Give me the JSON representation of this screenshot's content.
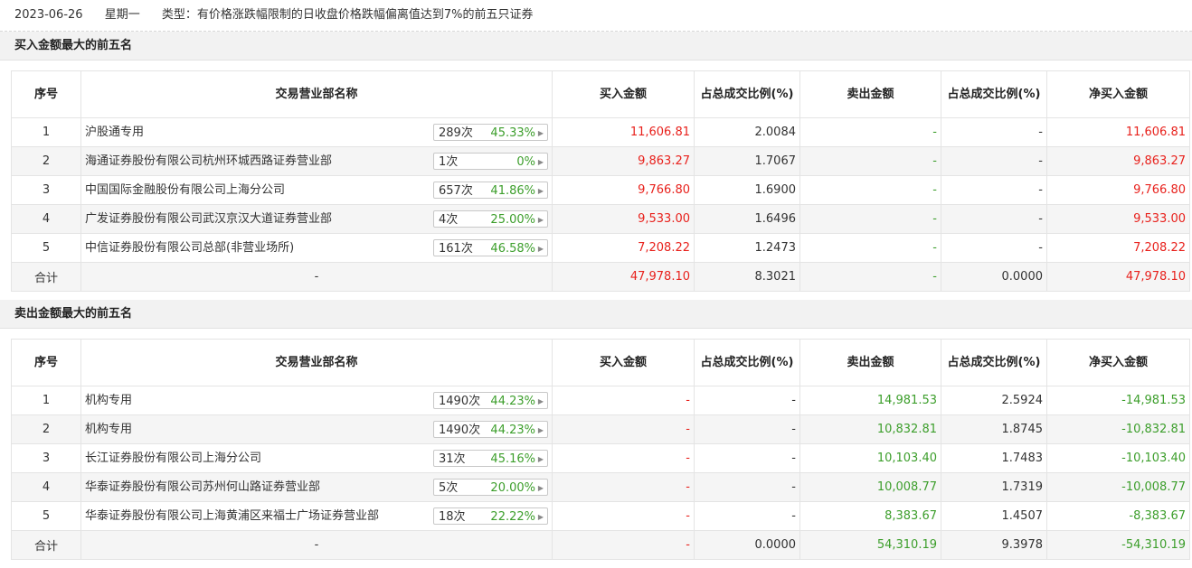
{
  "header": {
    "date": "2023-06-26",
    "weekday": "星期一",
    "type_label": "类型：",
    "type_text": "有价格涨跌幅限制的日收盘价格跌幅偏离值达到7%的前五只证券"
  },
  "columns": [
    "序号",
    "交易营业部名称",
    "买入金额",
    "占总成交比例(%)",
    "卖出金额",
    "占总成交比例(%)",
    "净买入金额"
  ],
  "buy_section": {
    "title": "买入金额最大的前五名",
    "rows": [
      {
        "no": "1",
        "name": "沪股通专用",
        "count": "289次",
        "pct": "45.33%",
        "buy": "11,606.81",
        "buy_ratio": "2.0084",
        "sell": "-",
        "sell_ratio": "-",
        "net": "11,606.81"
      },
      {
        "no": "2",
        "name": "海通证券股份有限公司杭州环城西路证券营业部",
        "count": "1次",
        "pct": "0%",
        "buy": "9,863.27",
        "buy_ratio": "1.7067",
        "sell": "-",
        "sell_ratio": "-",
        "net": "9,863.27"
      },
      {
        "no": "3",
        "name": "中国国际金融股份有限公司上海分公司",
        "count": "657次",
        "pct": "41.86%",
        "buy": "9,766.80",
        "buy_ratio": "1.6900",
        "sell": "-",
        "sell_ratio": "-",
        "net": "9,766.80"
      },
      {
        "no": "4",
        "name": "广发证券股份有限公司武汉京汉大道证券营业部",
        "count": "4次",
        "pct": "25.00%",
        "buy": "9,533.00",
        "buy_ratio": "1.6496",
        "sell": "-",
        "sell_ratio": "-",
        "net": "9,533.00"
      },
      {
        "no": "5",
        "name": "中信证券股份有限公司总部(非营业场所)",
        "count": "161次",
        "pct": "46.58%",
        "buy": "7,208.22",
        "buy_ratio": "1.2473",
        "sell": "-",
        "sell_ratio": "-",
        "net": "7,208.22"
      }
    ],
    "total": {
      "label": "合计",
      "name": "-",
      "buy": "47,978.10",
      "buy_ratio": "8.3021",
      "sell": "-",
      "sell_ratio": "0.0000",
      "net": "47,978.10"
    }
  },
  "sell_section": {
    "title": "卖出金额最大的前五名",
    "rows": [
      {
        "no": "1",
        "name": "机构专用",
        "count": "1490次",
        "pct": "44.23%",
        "buy": "-",
        "buy_ratio": "-",
        "sell": "14,981.53",
        "sell_ratio": "2.5924",
        "net": "-14,981.53"
      },
      {
        "no": "2",
        "name": "机构专用",
        "count": "1490次",
        "pct": "44.23%",
        "buy": "-",
        "buy_ratio": "-",
        "sell": "10,832.81",
        "sell_ratio": "1.8745",
        "net": "-10,832.81"
      },
      {
        "no": "3",
        "name": "长江证券股份有限公司上海分公司",
        "count": "31次",
        "pct": "45.16%",
        "buy": "-",
        "buy_ratio": "-",
        "sell": "10,103.40",
        "sell_ratio": "1.7483",
        "net": "-10,103.40"
      },
      {
        "no": "4",
        "name": "华泰证券股份有限公司苏州何山路证券营业部",
        "count": "5次",
        "pct": "20.00%",
        "buy": "-",
        "buy_ratio": "-",
        "sell": "10,008.77",
        "sell_ratio": "1.7319",
        "net": "-10,008.77"
      },
      {
        "no": "5",
        "name": "华泰证券股份有限公司上海黄浦区来福士广场证券营业部",
        "count": "18次",
        "pct": "22.22%",
        "buy": "-",
        "buy_ratio": "-",
        "sell": "8,383.67",
        "sell_ratio": "1.4507",
        "net": "-8,383.67"
      }
    ],
    "total": {
      "label": "合计",
      "name": "-",
      "buy": "-",
      "buy_ratio": "0.0000",
      "sell": "54,310.19",
      "sell_ratio": "9.3978",
      "net": "-54,310.19"
    }
  },
  "colors": {
    "up": "#e8211c",
    "down": "#3c9e2b",
    "neutral": "#333333"
  },
  "icons": {
    "badge_arrow": "caret-right-icon"
  }
}
